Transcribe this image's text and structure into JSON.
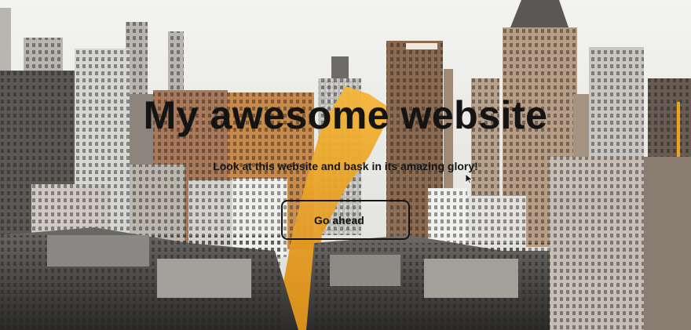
{
  "hero": {
    "title": "My awesome website",
    "subtitle": "Look at this website and bask in its amazing glory!",
    "button_label": "Go ahead",
    "background_image": "city-skyline-icon"
  },
  "colors": {
    "text": "#141414",
    "accent_yellow": "#f0a21f",
    "sky": "#ececea"
  }
}
